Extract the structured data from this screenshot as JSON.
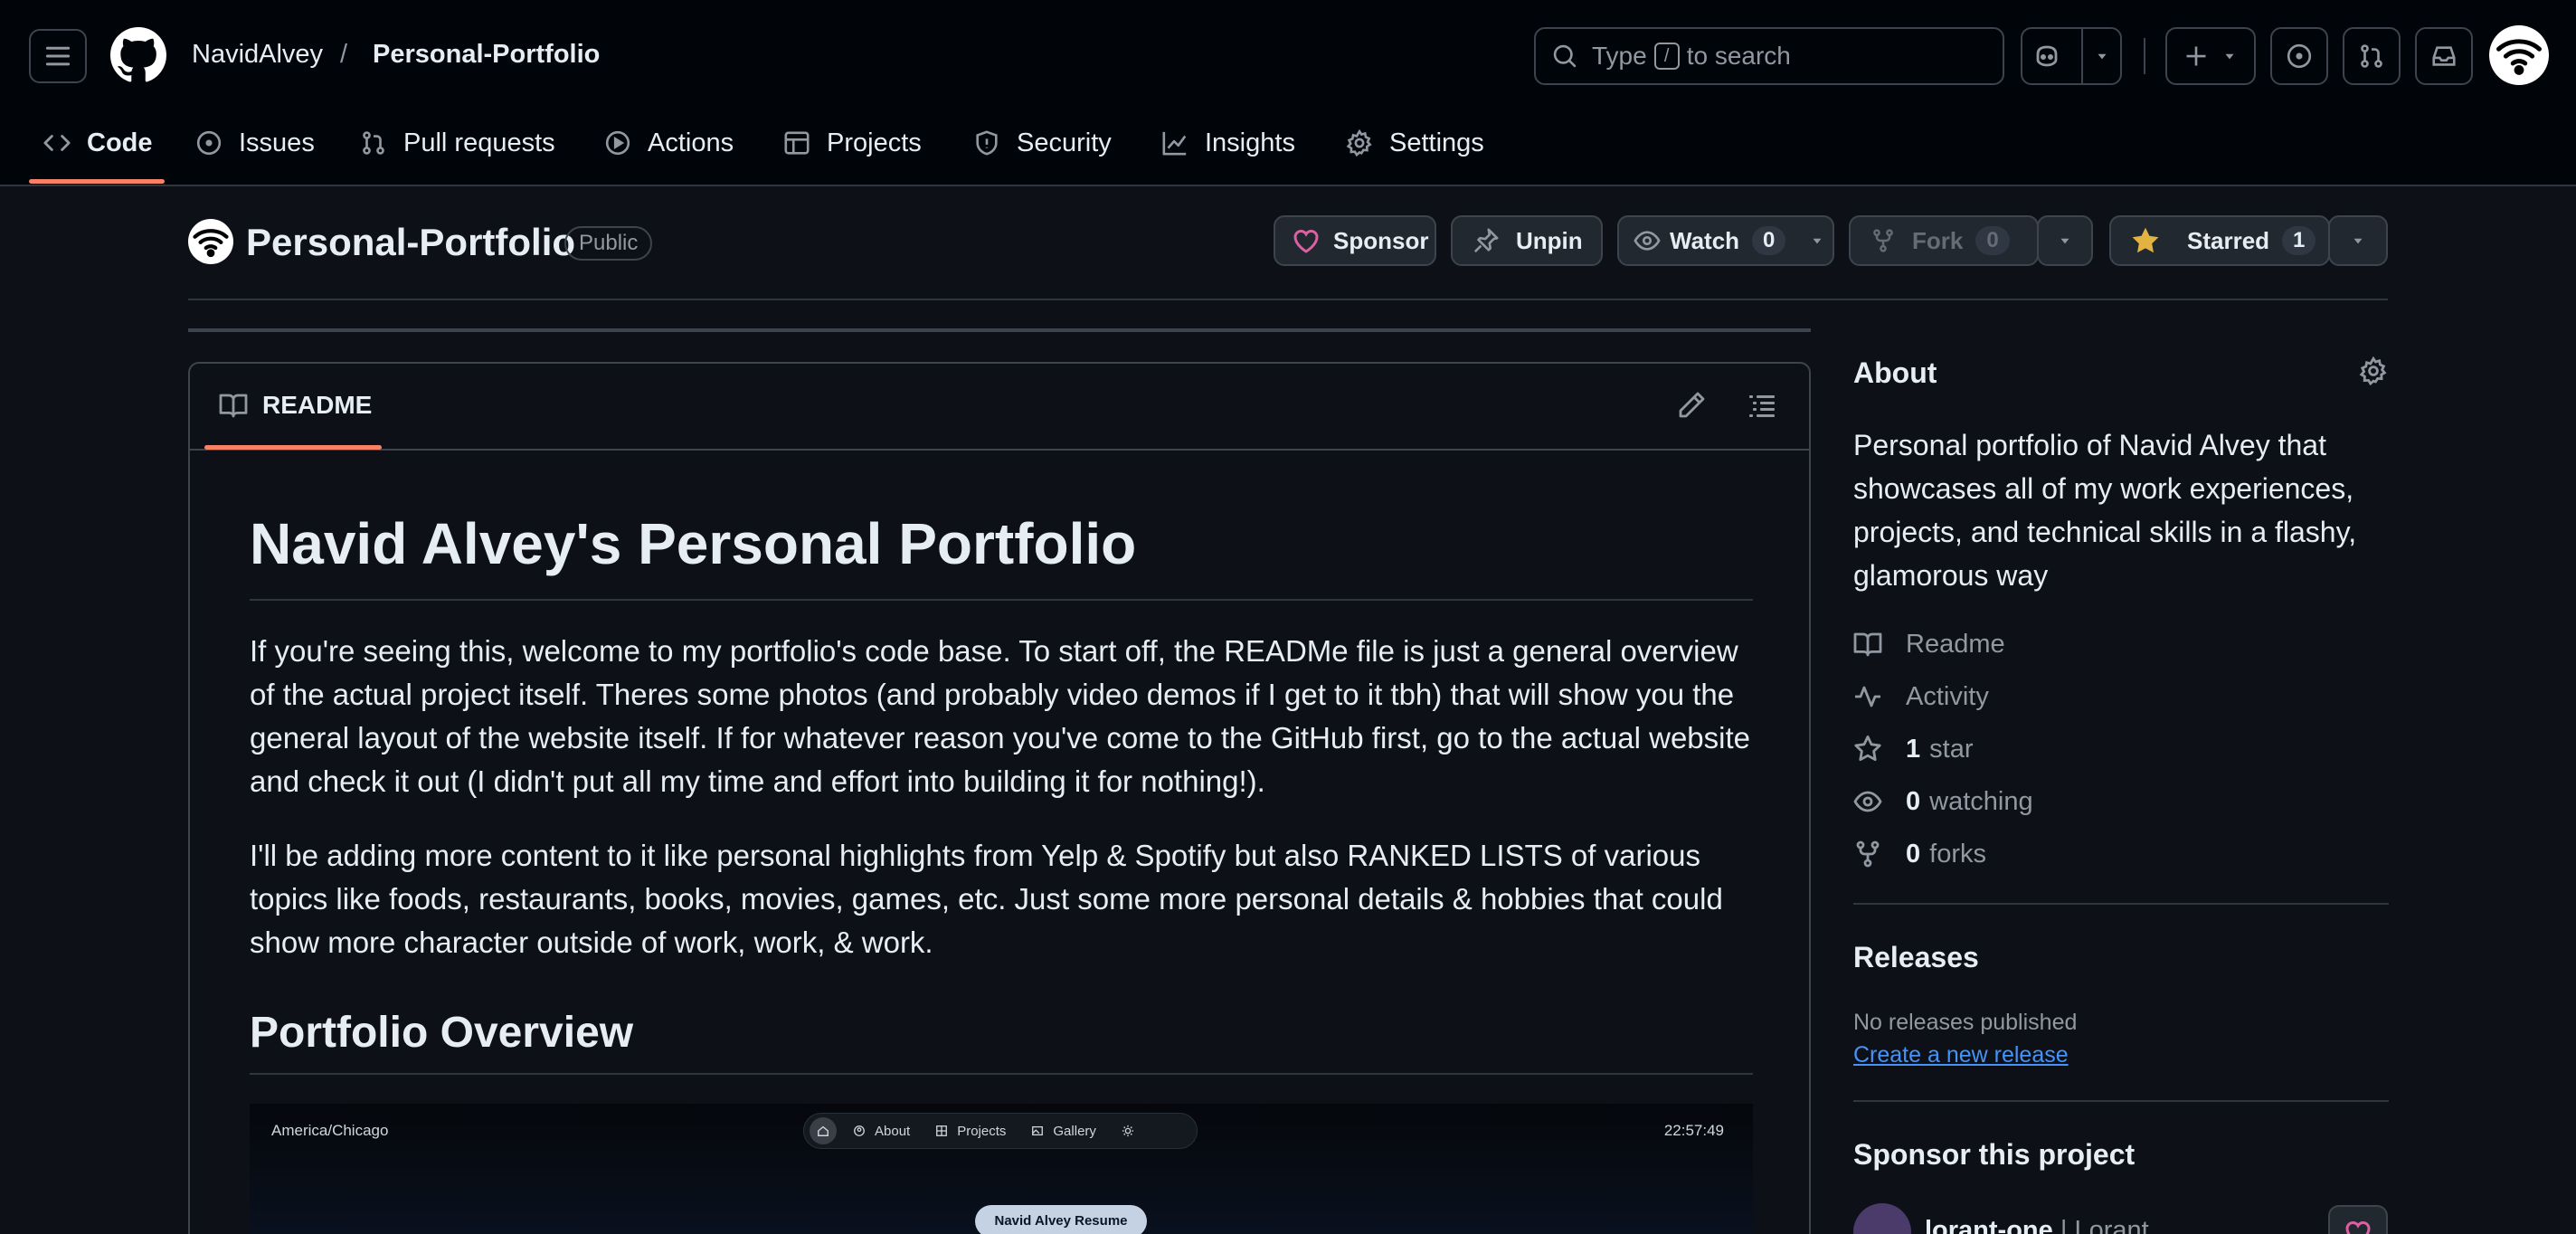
{
  "header": {
    "owner": "NavidAlvey",
    "separator": "/",
    "repo": "Personal-Portfolio",
    "search_prefix": "Type",
    "search_key": "/",
    "search_suffix": "to search"
  },
  "nav": {
    "tabs": [
      {
        "label": "Code",
        "icon": "code-icon",
        "active": true
      },
      {
        "label": "Issues",
        "icon": "issue-icon"
      },
      {
        "label": "Pull requests",
        "icon": "pull-request-icon"
      },
      {
        "label": "Actions",
        "icon": "play-icon"
      },
      {
        "label": "Projects",
        "icon": "table-icon"
      },
      {
        "label": "Security",
        "icon": "shield-icon"
      },
      {
        "label": "Insights",
        "icon": "graph-icon"
      },
      {
        "label": "Settings",
        "icon": "gear-icon"
      }
    ]
  },
  "repo": {
    "title": "Personal-Portfolio",
    "visibility": "Public",
    "sponsor_label": "Sponsor",
    "unpin_label": "Unpin",
    "watch_label": "Watch",
    "watch_count": "0",
    "fork_label": "Fork",
    "fork_count": "0",
    "star_label": "Starred",
    "star_count": "1"
  },
  "readme": {
    "tab_label": "README",
    "title": "Navid Alvey's Personal Portfolio",
    "para1": "If you're seeing this, welcome to my portfolio's code base. To start off, the READMe file is just a general overview of the actual project itself. Theres some photos (and probably video demos if I get to it tbh) that will show you the general layout of the website itself. If for whatever reason you've come to the GitHub first, go to the actual website and check it out (I didn't put all my time and effort into building it for nothing!).",
    "para2": "I'll be adding more content to it like personal highlights from Yelp & Spotify but also RANKED LISTS of various topics like foods, restaurants, books, movies, games, etc. Just some more personal details & hobbies that could show more character outside of work, work, & work.",
    "section_title": "Portfolio Overview",
    "preview": {
      "timezone": "America/Chicago",
      "nav": [
        "About",
        "Projects",
        "Gallery"
      ],
      "time": "22:57:49",
      "button": "Navid Alvey Resume"
    }
  },
  "sidebar": {
    "about_title": "About",
    "description": "Personal portfolio of Navid Alvey that showcases all of my work experiences, projects, and technical skills in a flashy, glamorous way",
    "readme": "Readme",
    "activity": "Activity",
    "stars_count": "1",
    "stars_label": "star",
    "watching_count": "0",
    "watching_label": "watching",
    "forks_count": "0",
    "forks_label": "forks",
    "releases_title": "Releases",
    "no_releases": "No releases published",
    "create_release": "Create a new release",
    "sponsor_title": "Sponsor this project",
    "sponsor_user": "lorant-one",
    "sponsor_name": "Lorant"
  },
  "colors": {
    "accent_underline": "#f78166",
    "link": "#4493f8",
    "sponsor_heart": "#db61a2",
    "star": "#e3b341"
  }
}
